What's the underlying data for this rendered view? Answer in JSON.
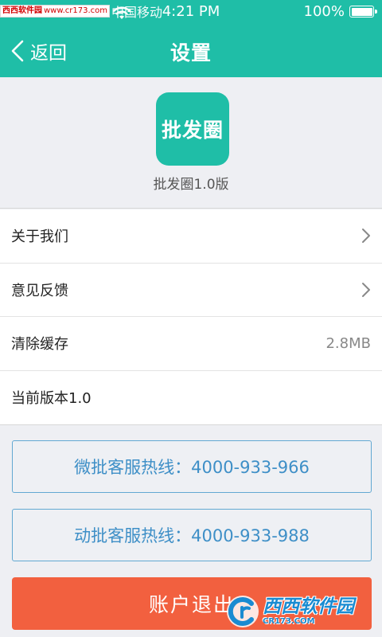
{
  "watermark_top": {
    "name": "西西软件园",
    "url": "www.cr173.com"
  },
  "status_bar": {
    "carrier": "中国移动",
    "time": "4:21 PM",
    "battery": "100%"
  },
  "nav": {
    "back_label": "返回",
    "title": "设置"
  },
  "app": {
    "logo_text": "批发圈",
    "version": "批发圈1.0版"
  },
  "settings": {
    "items": [
      {
        "label": "关于我们",
        "icon": "chevron-right-icon"
      },
      {
        "label": "意见反馈",
        "icon": "chevron-right-icon"
      },
      {
        "label": "清除缓存",
        "value": "2.8MB"
      },
      {
        "label": "当前版本1.0"
      }
    ]
  },
  "hotlines": {
    "weipi": "微批客服热线：4000-933-966",
    "dongpi": "动批客服热线：4000-933-988"
  },
  "logout_label": "账户退出",
  "watermark_bottom": {
    "main": "西西软件园",
    "sub": "CR173.COM"
  },
  "colors": {
    "brand": "#1fbea7",
    "hotline_text": "#3e8fc7",
    "logout": "#f2603f",
    "background": "#eeeff3"
  }
}
